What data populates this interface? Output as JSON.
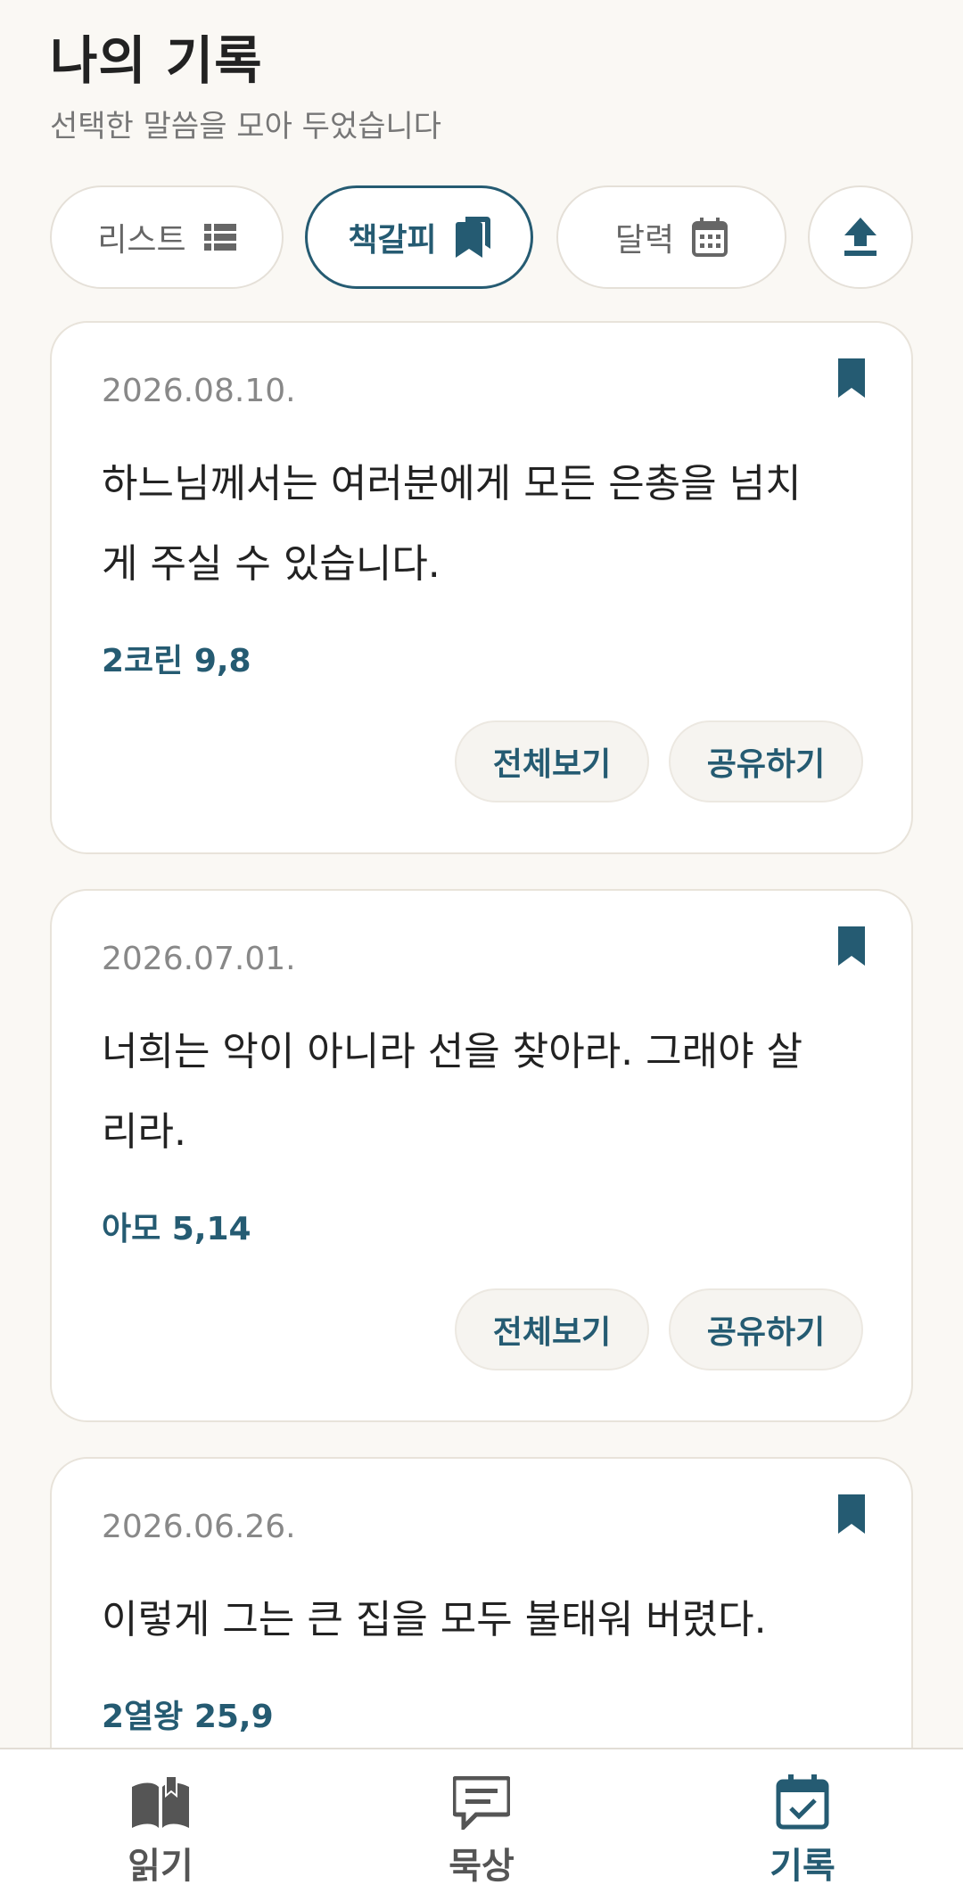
{
  "header": {
    "title": "나의 기록",
    "subtitle": "선택한 말씀을 모아 두었습니다"
  },
  "tabs": [
    {
      "label": "리스트",
      "icon": "list-icon"
    },
    {
      "label": "책갈피",
      "icon": "bookmark-icon"
    },
    {
      "label": "달력",
      "icon": "calendar-icon"
    },
    {
      "label": "",
      "icon": "upload-icon"
    }
  ],
  "cards": [
    {
      "date": "2026.08.10.",
      "verse": "하느님께서는 여러분에게 모든 은총을 넘치게 주실 수 있습니다.",
      "ref": "2코린 9,8",
      "view_label": "전체보기",
      "share_label": "공유하기"
    },
    {
      "date": "2026.07.01.",
      "verse": "너희는 악이 아니라 선을 찾아라. 그래야 살리라.",
      "ref": "아모 5,14",
      "view_label": "전체보기",
      "share_label": "공유하기"
    },
    {
      "date": "2026.06.26.",
      "verse": "이렇게 그는 큰 집을 모두 불태워 버렸다.",
      "ref": "2열왕 25,9"
    }
  ],
  "nav": [
    {
      "label": "읽기",
      "icon": "open-book-icon"
    },
    {
      "label": "묵상",
      "icon": "chat-icon"
    },
    {
      "label": "기록",
      "icon": "calendar-check-icon"
    }
  ],
  "colors": {
    "accent": "#255b72",
    "background": "#faf8f4",
    "card": "#ffffff",
    "nav_icon": "#555555"
  }
}
